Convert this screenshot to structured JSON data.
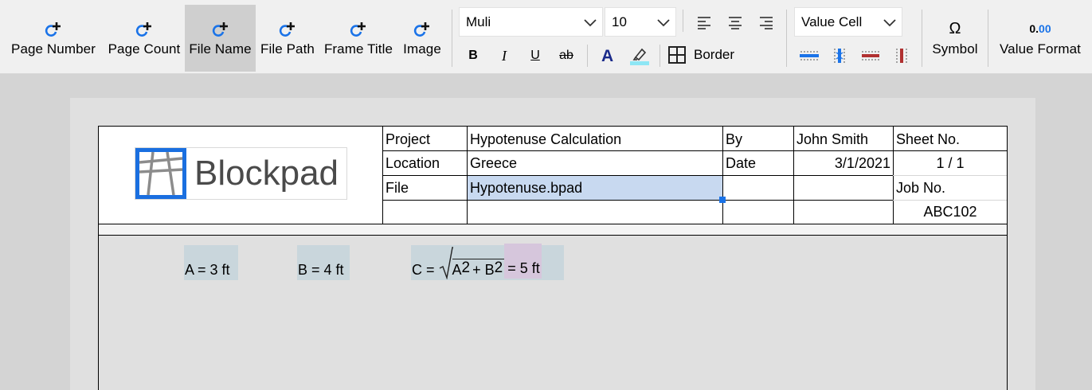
{
  "toolbar": {
    "insert_buttons": [
      {
        "label": "Page Number",
        "icon": "add-field-icon"
      },
      {
        "label": "Page Count",
        "icon": "add-field-icon"
      },
      {
        "label": "File Name",
        "icon": "add-field-icon"
      },
      {
        "label": "File Path",
        "icon": "add-field-icon"
      },
      {
        "label": "Frame Title",
        "icon": "add-field-icon"
      },
      {
        "label": "Image",
        "icon": "add-field-icon"
      }
    ],
    "active_button": "File Name",
    "font_family": "Muli",
    "font_size": "10",
    "format_buttons": [
      {
        "name": "bold",
        "glyph": "B"
      },
      {
        "name": "italic",
        "glyph": "I"
      },
      {
        "name": "underline",
        "glyph": "U"
      },
      {
        "name": "strikethrough",
        "glyph": "ab"
      }
    ],
    "border_label": "Border",
    "cell_type": "Value Cell",
    "symbol_glyph": "Ω",
    "symbol_label": "Symbol",
    "value_format_glyph_int": "0.",
    "value_format_glyph_dec": "00",
    "value_format_label": "Value Format",
    "colors": {
      "accent": "#1a73e8",
      "font_color": "#1a2a8a",
      "highlight": "#8ee6f5",
      "delete_red": "#b03030"
    }
  },
  "titleblock": {
    "logo_text": "Blockpad",
    "project_label": "Project",
    "project_value": "Hypotenuse Calculation",
    "location_label": "Location",
    "location_value": "Greece",
    "file_label": "File",
    "file_value": "Hypotenuse.bpad",
    "by_label": "By",
    "by_value": "John Smith",
    "date_label": "Date",
    "date_value": "3/1/2021",
    "sheet_label": "Sheet No.",
    "sheet_value": "1 / 1",
    "job_label": "Job No.",
    "job_value": "ABC102"
  },
  "equations": {
    "a": "A = 3 ft",
    "b": "B = 4 ft",
    "c_lhs": "C =",
    "c_var_a": "A",
    "c_exp": "2",
    "c_plus": "+ B",
    "c_result": "= 5 ft"
  }
}
